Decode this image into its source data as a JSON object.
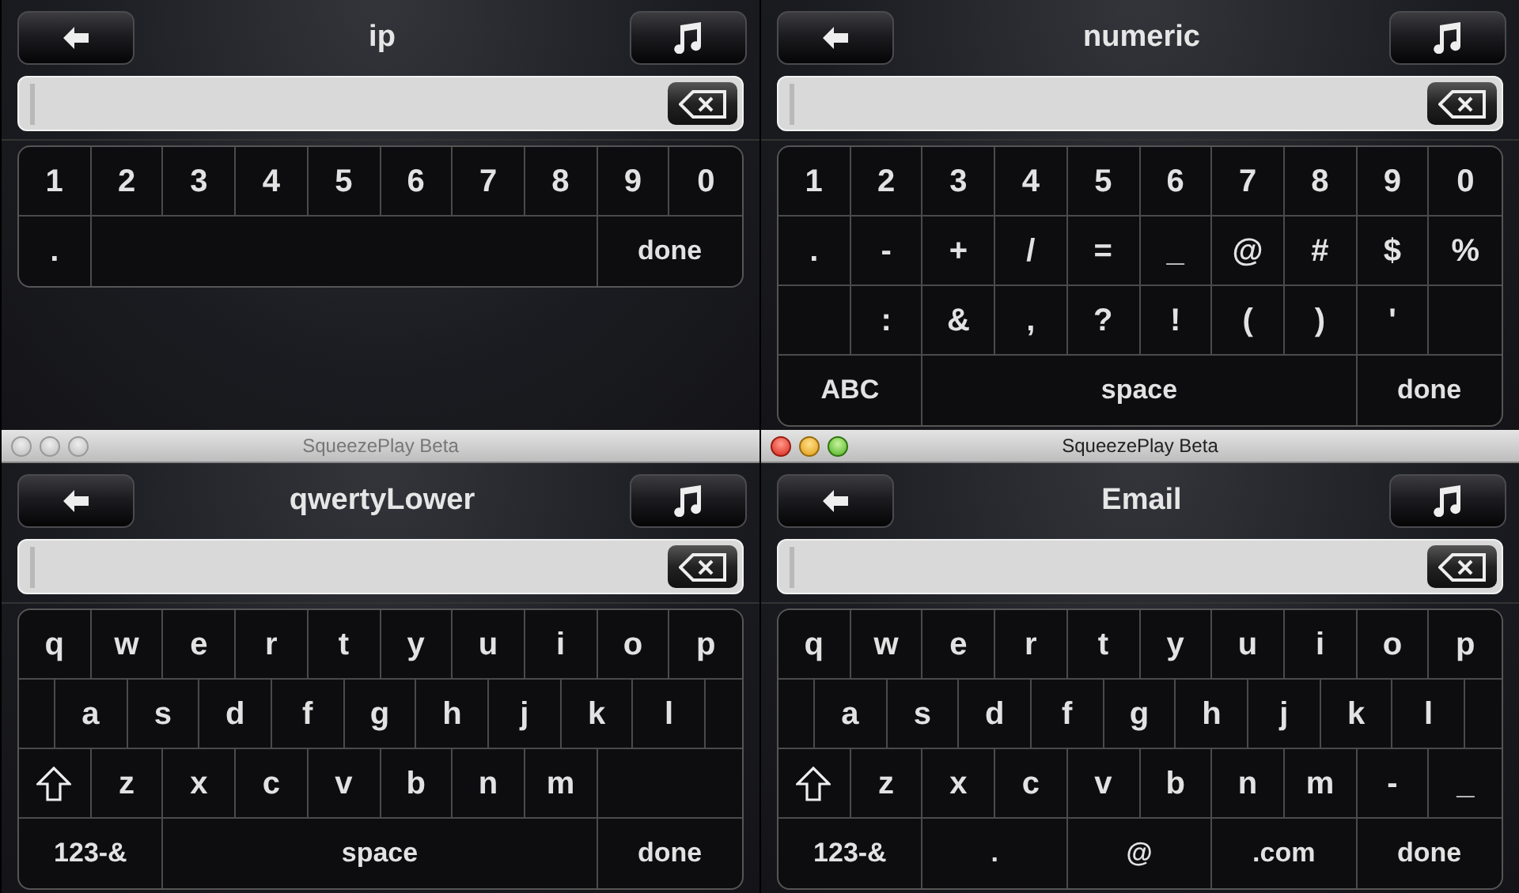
{
  "windows": [
    {
      "heading": "ip",
      "keyboard": [
        [
          {
            "kind": "char",
            "label": "1"
          },
          {
            "kind": "char",
            "label": "2"
          },
          {
            "kind": "char",
            "label": "3"
          },
          {
            "kind": "char",
            "label": "4"
          },
          {
            "kind": "char",
            "label": "5"
          },
          {
            "kind": "char",
            "label": "6"
          },
          {
            "kind": "char",
            "label": "7"
          },
          {
            "kind": "char",
            "label": "8"
          },
          {
            "kind": "char",
            "label": "9"
          },
          {
            "kind": "char",
            "label": "0"
          }
        ],
        [
          {
            "kind": "char",
            "label": "."
          },
          {
            "kind": "gap"
          },
          {
            "kind": "function",
            "label": "done"
          }
        ]
      ]
    },
    {
      "heading": "numeric",
      "keyboard": [
        [
          {
            "kind": "char",
            "label": "1"
          },
          {
            "kind": "char",
            "label": "2"
          },
          {
            "kind": "char",
            "label": "3"
          },
          {
            "kind": "char",
            "label": "4"
          },
          {
            "kind": "char",
            "label": "5"
          },
          {
            "kind": "char",
            "label": "6"
          },
          {
            "kind": "char",
            "label": "7"
          },
          {
            "kind": "char",
            "label": "8"
          },
          {
            "kind": "char",
            "label": "9"
          },
          {
            "kind": "char",
            "label": "0"
          }
        ],
        [
          {
            "kind": "char",
            "label": "."
          },
          {
            "kind": "char",
            "label": "-"
          },
          {
            "kind": "char",
            "label": "+"
          },
          {
            "kind": "char",
            "label": "/"
          },
          {
            "kind": "char",
            "label": "="
          },
          {
            "kind": "char",
            "label": "_"
          },
          {
            "kind": "char",
            "label": "@"
          },
          {
            "kind": "char",
            "label": "#"
          },
          {
            "kind": "char",
            "label": "$"
          },
          {
            "kind": "char",
            "label": "%"
          }
        ],
        [
          {
            "kind": "gap"
          },
          {
            "kind": "char",
            "label": ":"
          },
          {
            "kind": "char",
            "label": "&"
          },
          {
            "kind": "char",
            "label": ","
          },
          {
            "kind": "char",
            "label": "?"
          },
          {
            "kind": "char",
            "label": "!"
          },
          {
            "kind": "char",
            "label": "("
          },
          {
            "kind": "char",
            "label": ")"
          },
          {
            "kind": "char",
            "label": "'"
          },
          {
            "kind": "gap"
          }
        ],
        [
          {
            "kind": "function",
            "label": "ABC"
          },
          {
            "kind": "fill",
            "label": "space"
          },
          {
            "kind": "function",
            "label": "done"
          }
        ]
      ]
    },
    {
      "title_bar": {
        "title": "SqueezePlay Beta",
        "active": false
      },
      "heading": "qwertyLower",
      "keyboard": [
        [
          {
            "kind": "char",
            "label": "q"
          },
          {
            "kind": "char",
            "label": "w"
          },
          {
            "kind": "char",
            "label": "e"
          },
          {
            "kind": "char",
            "label": "r"
          },
          {
            "kind": "char",
            "label": "t"
          },
          {
            "kind": "char",
            "label": "y"
          },
          {
            "kind": "char",
            "label": "u"
          },
          {
            "kind": "char",
            "label": "i"
          },
          {
            "kind": "char",
            "label": "o"
          },
          {
            "kind": "char",
            "label": "p"
          }
        ],
        [
          {
            "kind": "gap"
          },
          {
            "kind": "char",
            "label": "a"
          },
          {
            "kind": "char",
            "label": "s"
          },
          {
            "kind": "char",
            "label": "d"
          },
          {
            "kind": "char",
            "label": "f"
          },
          {
            "kind": "char",
            "label": "g"
          },
          {
            "kind": "char",
            "label": "h"
          },
          {
            "kind": "char",
            "label": "j"
          },
          {
            "kind": "char",
            "label": "k"
          },
          {
            "kind": "char",
            "label": "l"
          },
          {
            "kind": "gap"
          }
        ],
        [
          {
            "kind": "shift"
          },
          {
            "kind": "char",
            "label": "z"
          },
          {
            "kind": "char",
            "label": "x"
          },
          {
            "kind": "char",
            "label": "c"
          },
          {
            "kind": "char",
            "label": "v"
          },
          {
            "kind": "char",
            "label": "b"
          },
          {
            "kind": "char",
            "label": "n"
          },
          {
            "kind": "char",
            "label": "m"
          },
          {
            "kind": "gap"
          }
        ],
        [
          {
            "kind": "function",
            "label": "123-&"
          },
          {
            "kind": "fill",
            "label": "space"
          },
          {
            "kind": "function",
            "label": "done"
          }
        ]
      ]
    },
    {
      "title_bar": {
        "title": "SqueezePlay Beta",
        "active": true
      },
      "heading": "Email",
      "keyboard": [
        [
          {
            "kind": "char",
            "label": "q"
          },
          {
            "kind": "char",
            "label": "w"
          },
          {
            "kind": "char",
            "label": "e"
          },
          {
            "kind": "char",
            "label": "r"
          },
          {
            "kind": "char",
            "label": "t"
          },
          {
            "kind": "char",
            "label": "y"
          },
          {
            "kind": "char",
            "label": "u"
          },
          {
            "kind": "char",
            "label": "i"
          },
          {
            "kind": "char",
            "label": "o"
          },
          {
            "kind": "char",
            "label": "p"
          }
        ],
        [
          {
            "kind": "gap"
          },
          {
            "kind": "char",
            "label": "a"
          },
          {
            "kind": "char",
            "label": "s"
          },
          {
            "kind": "char",
            "label": "d"
          },
          {
            "kind": "char",
            "label": "f"
          },
          {
            "kind": "char",
            "label": "g"
          },
          {
            "kind": "char",
            "label": "h"
          },
          {
            "kind": "char",
            "label": "j"
          },
          {
            "kind": "char",
            "label": "k"
          },
          {
            "kind": "char",
            "label": "l"
          },
          {
            "kind": "gap"
          }
        ],
        [
          {
            "kind": "shift"
          },
          {
            "kind": "char",
            "label": "z"
          },
          {
            "kind": "char",
            "label": "x"
          },
          {
            "kind": "char",
            "label": "c"
          },
          {
            "kind": "char",
            "label": "v"
          },
          {
            "kind": "char",
            "label": "b"
          },
          {
            "kind": "char",
            "label": "n"
          },
          {
            "kind": "char",
            "label": "m"
          },
          {
            "kind": "char",
            "label": "-"
          },
          {
            "kind": "char",
            "label": "_"
          }
        ],
        [
          {
            "kind": "function",
            "label": "123-&"
          },
          {
            "kind": "function",
            "label": "."
          },
          {
            "kind": "function",
            "label": "@"
          },
          {
            "kind": "function",
            "label": ".com"
          },
          {
            "kind": "function",
            "label": "done"
          }
        ]
      ]
    }
  ]
}
